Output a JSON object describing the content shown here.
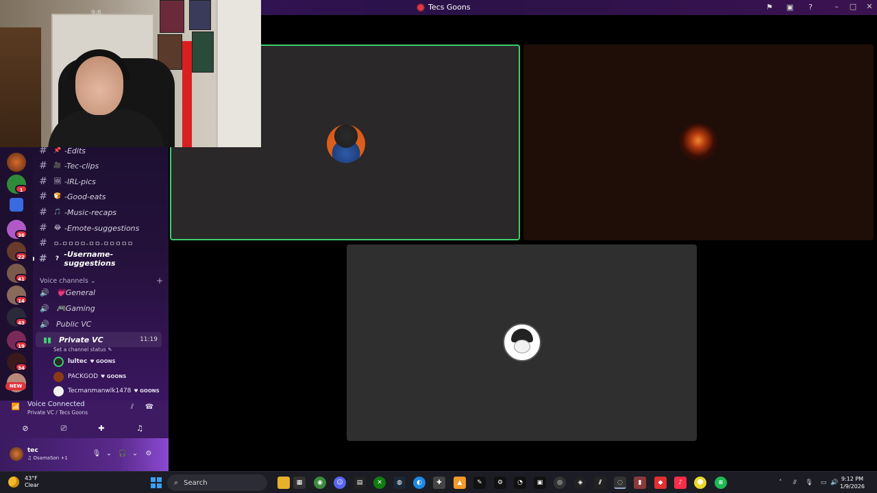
{
  "titlebar": {
    "title": "Tecs Goons"
  },
  "channels": [
    {
      "name": "-Edits",
      "emoji": "📌",
      "bold": false
    },
    {
      "name": "-Tec-clips",
      "emoji": "🎥",
      "bold": false
    },
    {
      "name": "-IRL-pics",
      "emoji": "🖼",
      "bold": false
    },
    {
      "name": "-Good-eats",
      "emoji": "🍞",
      "bold": false
    },
    {
      "name": "-Music-recaps",
      "emoji": "🎵",
      "bold": false
    },
    {
      "name": "-Emote-suggestions",
      "emoji": "😂",
      "bold": false
    },
    {
      "name": "ㅁ-ㅁㅁㅁㅁ-ㅁㅁ-ㅁㅁㅁㅁㅁ",
      "emoji": "",
      "bold": false
    },
    {
      "name": "-Username-suggestions",
      "emoji": "?",
      "bold": true
    }
  ],
  "voice_section": {
    "header": "Voice channels",
    "channels": [
      {
        "name": "General",
        "emoji": "💗"
      },
      {
        "name": "Gaming",
        "emoji": "🎮"
      },
      {
        "name": "Public VC",
        "emoji": ""
      }
    ],
    "active": {
      "name": "Private VC",
      "time": "11:19",
      "status_prompt": "Set a channel status"
    },
    "members": [
      {
        "name": "lultec",
        "tag": "GOONS",
        "bold": true
      },
      {
        "name": "PACKGOD",
        "tag": "GOONS",
        "bold": false
      },
      {
        "name": "Tecmanmanwlk1478",
        "tag": "GOONS",
        "bold": false
      }
    ]
  },
  "server_rail": {
    "badges": [
      "1",
      "36",
      "22",
      "41",
      "14",
      "43",
      "19",
      "34"
    ],
    "new_label": "NEW"
  },
  "voice_panel": {
    "status": "Voice Connected",
    "location": "Private VC / Tecs Goons"
  },
  "user_panel": {
    "username": "tec",
    "activity": "OsamaSon +1"
  },
  "webcam": {
    "watermark": "9:8"
  },
  "taskbar": {
    "temperature": "43°F",
    "condition": "Clear",
    "search_placeholder": "Search",
    "time": "9:12 PM",
    "date": "1/9/2026"
  },
  "colors": {
    "speaking_border": "#3ecf6e",
    "sidebar_bg": "#24113a",
    "accent": "#5a2a8c"
  }
}
